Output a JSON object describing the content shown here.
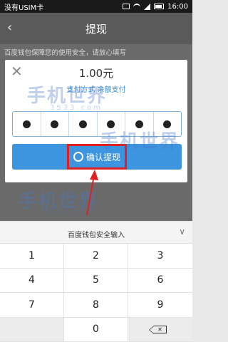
{
  "status_bar": {
    "carrier": "没有USIM卡",
    "time": "16:00"
  },
  "nav": {
    "title": "提现"
  },
  "hint": "百度钱包保障您的使用安全，请放心填写",
  "dialog": {
    "amount": "1.00元",
    "payment_method": "支付方式 余额支付",
    "pin_dots": 6,
    "confirm_label": "确认提现"
  },
  "keyboard": {
    "title": "百度钱包安全输入",
    "keys": [
      "1",
      "2",
      "3",
      "4",
      "5",
      "6",
      "7",
      "8",
      "9",
      "",
      "0",
      ""
    ]
  },
  "watermark": {
    "text": "手机世界",
    "sub": "3533.com"
  },
  "colors": {
    "accent": "#3d95e0",
    "highlight": "#e02020"
  }
}
